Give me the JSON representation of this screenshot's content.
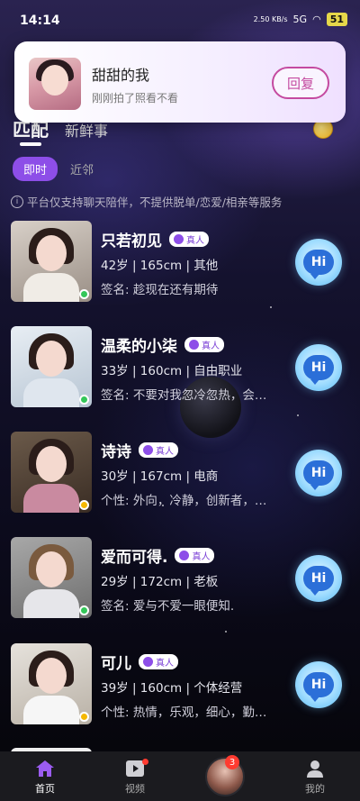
{
  "status_bar": {
    "time": "14:14",
    "network": "2.50 KB/s",
    "signal": "5G",
    "battery": "51"
  },
  "notification": {
    "sender": "甜甜的我",
    "message": "刚刚拍了照看不看",
    "reply_label": "回复"
  },
  "tabs": {
    "match": "匹配",
    "fresh": "新鲜事"
  },
  "sub_tabs": {
    "instant": "即时",
    "nearby": "近邻"
  },
  "notice": "平台仅支持聊天陪伴，不提供脱单/恋爱/相亲等服务",
  "verified_label": "真人",
  "hi_label": "Hi",
  "users": [
    {
      "name": "只若初见",
      "info": "42岁 | 165cm | 其他",
      "desc": "签名: 趁现在还有期待",
      "status_color": "#34c759"
    },
    {
      "name": "温柔的小柒",
      "info": "33岁 | 160cm | 自由职业",
      "desc": "签名: 不要对我忽冷忽热，会…",
      "status_color": "#34c759"
    },
    {
      "name": "诗诗",
      "info": "30岁 | 167cm | 电商",
      "desc": "个性: 外向，冷静，创新者，…",
      "status_color": "#f5b800"
    },
    {
      "name": "爱而可得.",
      "info": "29岁 | 172cm | 老板",
      "desc": "签名: 爱与不爱一眼便知.",
      "status_color": "#34c759"
    },
    {
      "name": "可儿",
      "info": "39岁 | 160cm | 个体经营",
      "desc": "个性: 热情，乐观，细心，勤…",
      "status_color": "#f5b800"
    }
  ],
  "nav": {
    "home": "首页",
    "video": "视频",
    "badge_count": "3",
    "mine": "我的"
  },
  "colors": {
    "accent": "#8d4ee8",
    "reply": "#c44aa0",
    "nav_bg": "#1b1b1f"
  }
}
